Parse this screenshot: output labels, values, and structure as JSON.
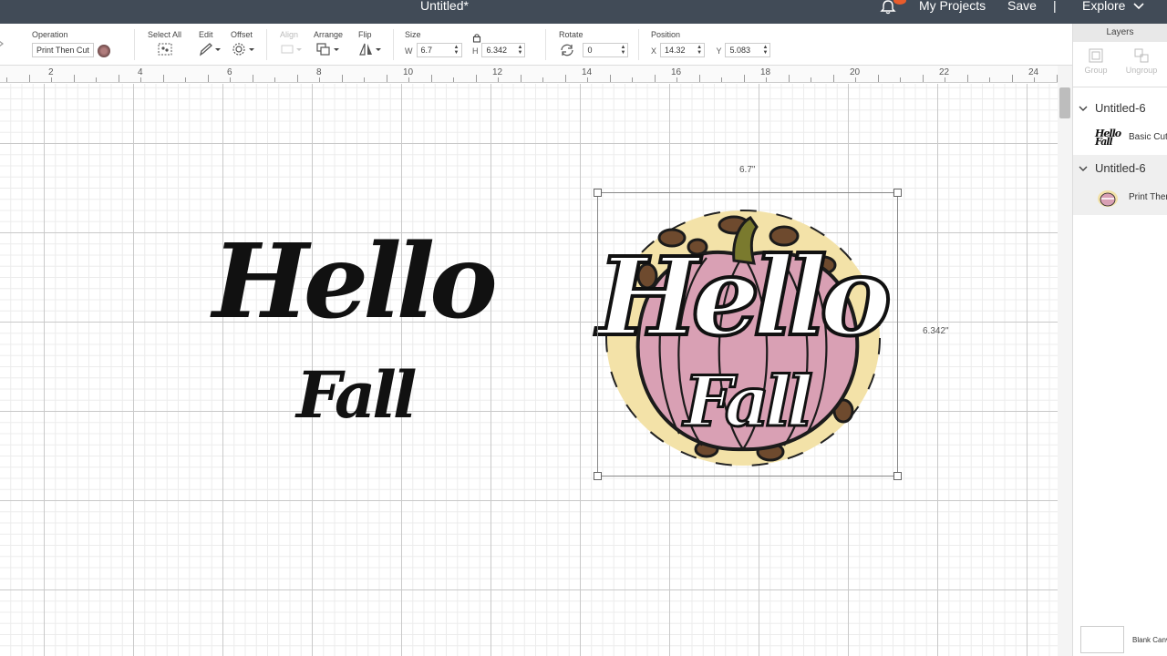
{
  "titlebar": {
    "title": "Untitled*",
    "my_projects": "My Projects",
    "save": "Save",
    "divider": "|",
    "explore": "Explore"
  },
  "toolbar": {
    "operation": {
      "label": "Operation",
      "value": "Print Then Cut"
    },
    "select_all": {
      "label": "Select All"
    },
    "edit": {
      "label": "Edit"
    },
    "offset": {
      "label": "Offset"
    },
    "align": {
      "label": "Align"
    },
    "arrange": {
      "label": "Arrange"
    },
    "flip": {
      "label": "Flip"
    },
    "size": {
      "label": "Size",
      "w_label": "W",
      "w_value": "6.7",
      "h_label": "H",
      "h_value": "6.342"
    },
    "rotate": {
      "label": "Rotate",
      "value": "0"
    },
    "position": {
      "label": "Position",
      "x_label": "X",
      "x_value": "14.32",
      "y_label": "Y",
      "y_value": "5.083"
    }
  },
  "ruler": {
    "numbers": [
      "2",
      "4",
      "6",
      "8",
      "10",
      "12",
      "14",
      "16",
      "18",
      "20",
      "22",
      "24"
    ]
  },
  "canvas": {
    "left_design": {
      "line1": "Hello",
      "line2": "Fall"
    },
    "right_design": {
      "line1": "Hello",
      "line2": "Fall"
    },
    "selection": {
      "width_label": "6.7\"",
      "height_label": "6.342\""
    }
  },
  "layers": {
    "header": "Layers",
    "group_label": "Group",
    "ungroup_label": "Ungroup",
    "groups": [
      {
        "name": "Untitled-6",
        "item_label": "Basic Cut",
        "thumb_text": "Hello Fall"
      },
      {
        "name": "Untitled-6",
        "item_label": "Print Then Cut"
      }
    ],
    "canvas_label": "Blank Canvas"
  },
  "colors": {
    "titlebar_bg": "#414b57",
    "notification": "#e85c2c",
    "pumpkin_pink": "#d9a0b4",
    "leopard_cream": "#f3e2a8",
    "stem_green": "#7a7a2e"
  }
}
